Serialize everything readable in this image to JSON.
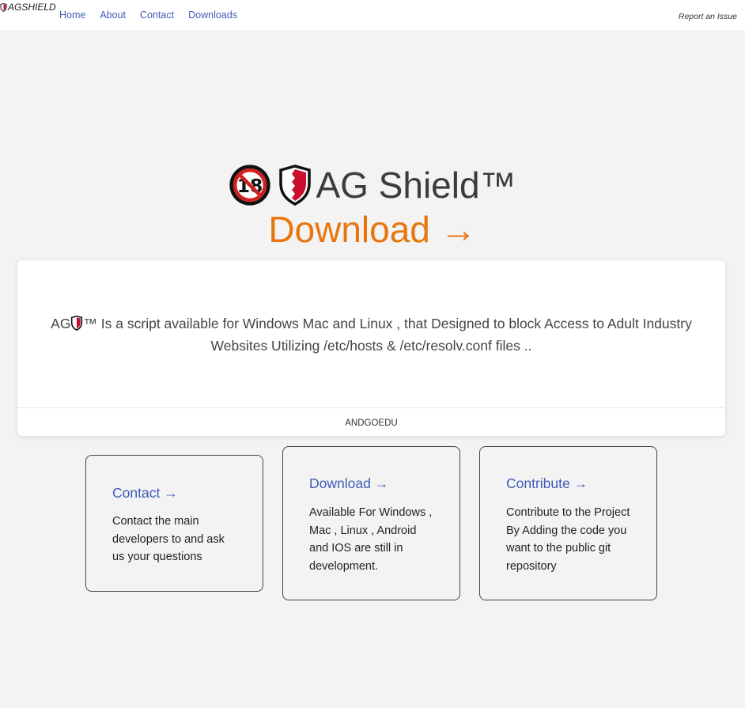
{
  "header": {
    "brand": "AGSHIELD",
    "nav": [
      "Home",
      "About",
      "Contact",
      "Downloads"
    ],
    "report_link": "Report an Issue"
  },
  "hero": {
    "title": "AG Shield™",
    "download_link": "Download →"
  },
  "about_card": {
    "prefix": "AG",
    "description": "™ Is a script available for Windows Mac and Linux , that Designed to block Access to Adult Industry Websites Utilizing /etc/hosts & /etc/resolv.conf files ..",
    "footer": "ANDGOEDU"
  },
  "features": [
    {
      "title": "Contact →",
      "text": "Contact the main developers to and ask us your questions"
    },
    {
      "title": "Download →",
      "text": "Available For Windows , Mac , Linux , Android and IOS are still in development."
    },
    {
      "title": "Contribute →",
      "text": "Contribute to the Project By Adding the code you want to the public git repository"
    }
  ],
  "colors": {
    "accent_orange": "#e8760e",
    "link_blue": "#3f5bb8",
    "shield_red": "#c8102e"
  },
  "icons": {
    "brand_logo": "shield-icon",
    "age_restriction": "no-18-icon",
    "hero_shield": "shield-icon"
  }
}
